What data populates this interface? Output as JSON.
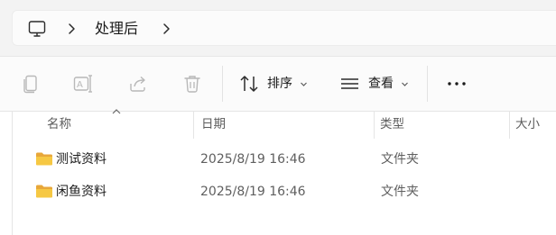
{
  "address": {
    "root_icon": "computer-monitor-icon",
    "separator_icon": "chevron-right-icon",
    "crumbs": [
      "处理后"
    ]
  },
  "toolbar": {
    "disabled_icons": [
      "copy-icon",
      "rename-icon",
      "share-icon",
      "delete-icon"
    ],
    "sort": {
      "icon": "sort-updown-icon",
      "label": "排序"
    },
    "view": {
      "icon": "view-lines-icon",
      "label": "查看"
    },
    "more_icon": "more-ellipsis-icon"
  },
  "columns": {
    "name": "名称",
    "date": "日期",
    "type": "类型",
    "size": "大小",
    "sorted_by": "name"
  },
  "files": [
    {
      "name": "测试资料",
      "date": "2025/8/19 16:46",
      "type": "文件夹",
      "size": "",
      "icon": "folder-icon"
    },
    {
      "name": "闲鱼资料",
      "date": "2025/8/19 16:46",
      "type": "文件夹",
      "size": "",
      "icon": "folder-icon"
    }
  ],
  "colors": {
    "folder": "#f0c040",
    "accent": "#0067c0",
    "disabled_icon": "#b8b8b8"
  }
}
